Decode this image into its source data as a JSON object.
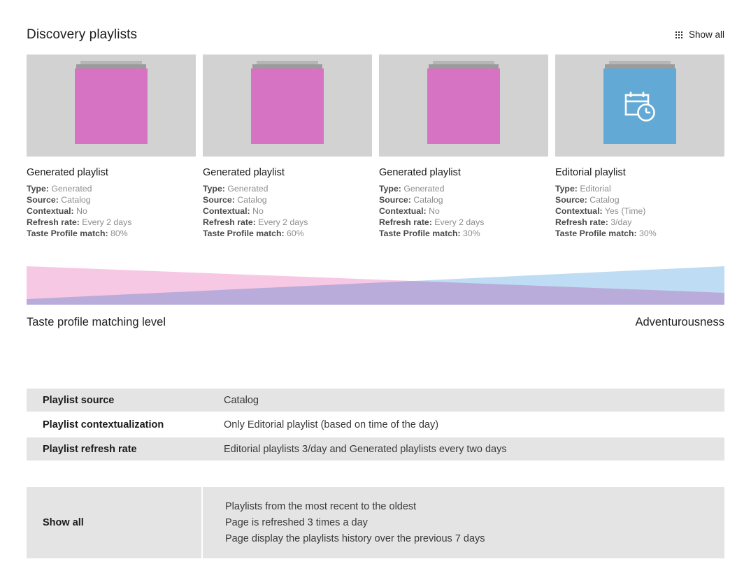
{
  "header": {
    "title": "Discovery playlists",
    "show_all_label": "Show all",
    "show_all_icon": "grid-dots-icon"
  },
  "cards": [
    {
      "title": "Generated playlist",
      "art_kind": "generated",
      "art_color": "#d673c3",
      "icon": "",
      "meta": [
        {
          "key": "Type:",
          "value": "Generated"
        },
        {
          "key": "Source:",
          "value": "Catalog"
        },
        {
          "key": "Contextual:",
          "value": "No"
        },
        {
          "key": "Refresh rate:",
          "value": "Every 2 days"
        },
        {
          "key": "Taste Profile match:",
          "value": "80%"
        }
      ]
    },
    {
      "title": "Generated playlist",
      "art_kind": "generated",
      "art_color": "#d673c3",
      "icon": "",
      "meta": [
        {
          "key": "Type:",
          "value": "Generated"
        },
        {
          "key": "Source:",
          "value": "Catalog"
        },
        {
          "key": "Contextual:",
          "value": "No"
        },
        {
          "key": "Refresh rate:",
          "value": "Every 2 days"
        },
        {
          "key": "Taste Profile match:",
          "value": "60%"
        }
      ]
    },
    {
      "title": "Generated playlist",
      "art_kind": "generated",
      "art_color": "#d673c3",
      "icon": "",
      "meta": [
        {
          "key": "Type:",
          "value": "Generated"
        },
        {
          "key": "Source:",
          "value": "Catalog"
        },
        {
          "key": "Contextual:",
          "value": "No"
        },
        {
          "key": "Refresh rate:",
          "value": "Every 2 days"
        },
        {
          "key": "Taste Profile match:",
          "value": "30%"
        }
      ]
    },
    {
      "title": "Editorial playlist",
      "art_kind": "editorial",
      "art_color": "#63a9d6",
      "icon": "calendar-clock-icon",
      "meta": [
        {
          "key": "Type:",
          "value": "Editorial"
        },
        {
          "key": "Source:",
          "value": "Catalog"
        },
        {
          "key": "Contextual:",
          "value": "Yes (Time)"
        },
        {
          "key": "Refresh rate:",
          "value": "3/day"
        },
        {
          "key": "Taste Profile match:",
          "value": "30%"
        }
      ]
    }
  ],
  "band": {
    "left_label": "Taste profile matching level",
    "right_label": "Adventurousness",
    "pink_color": "#f7c8e4",
    "blue_color": "#bfdcf5",
    "overlap_color": "#c0b4e2"
  },
  "spec_table": {
    "rows": [
      {
        "label": "Playlist source",
        "value": "Catalog",
        "filled": true
      },
      {
        "label": "Playlist contextualization",
        "value": "Only Editorial playlist (based on time of the day)",
        "filled": false
      },
      {
        "label": "Playlist refresh rate",
        "value": "Editorial playlists 3/day and Generated playlists every two days",
        "filled": true
      }
    ]
  },
  "show_all_block": {
    "label": "Show all",
    "lines": [
      "Playlists from the most recent to the oldest",
      "Page is refreshed 3 times a day",
      "Page display the playlists history over the previous 7 days"
    ]
  }
}
